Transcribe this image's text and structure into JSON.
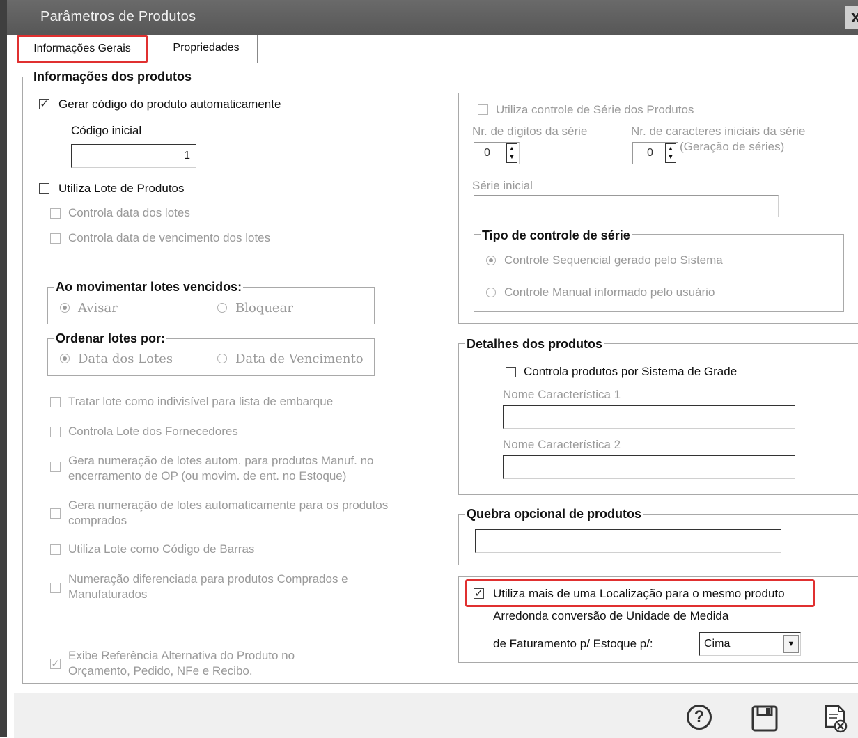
{
  "window": {
    "title": "Parâmetros de Produtos",
    "close_symbol": "x"
  },
  "tabs": [
    {
      "label": "Informações Gerais",
      "active": true
    },
    {
      "label": "Propriedades",
      "active": false
    }
  ],
  "info_produtos": {
    "legend": "Informações dos produtos",
    "gerar_codigo": {
      "label": "Gerar código do produto automaticamente",
      "checked": true
    },
    "codigo_inicial": {
      "label": "Código inicial",
      "value": "1"
    },
    "utiliza_lote": {
      "label": "Utiliza Lote de Produtos",
      "checked": false
    },
    "controla_data_lotes": {
      "label": "Controla data dos lotes",
      "checked": false
    },
    "controla_vencimento": {
      "label": "Controla data de vencimento dos lotes",
      "checked": false
    },
    "lotes_vencidos": {
      "legend": "Ao movimentar lotes vencidos:",
      "options": [
        "Avisar",
        "Bloquear"
      ],
      "selected": "Avisar"
    },
    "ordenar_lotes": {
      "legend": "Ordenar lotes por:",
      "options": [
        "Data dos Lotes",
        "Data de Vencimento"
      ],
      "selected": "Data dos Lotes"
    },
    "tratar_indivisivel": {
      "label": "Tratar lote como indivisível para lista de embarque",
      "checked": false
    },
    "controla_fornecedores": {
      "label": "Controla Lote dos Fornecedores",
      "checked": false
    },
    "gera_numeracao_manuf": {
      "line1": "Gera numeração de lotes autom. para produtos Manuf. no",
      "line2": "encerramento de OP (ou movim. de ent. no Estoque)",
      "checked": false
    },
    "gera_numeracao_comprados": {
      "line1": "Gera numeração de lotes automaticamente para os produtos",
      "line2": "comprados",
      "checked": false
    },
    "lote_codigo_barras": {
      "label": "Utiliza Lote como Código de Barras",
      "checked": false
    },
    "numeracao_diferenciada": {
      "line1": "Numeração diferenciada para produtos Comprados e",
      "line2": "Manufaturados",
      "checked": false
    },
    "exibe_referencia": {
      "line1": "Exibe Referência Alternativa do Produto no",
      "line2": "Orçamento, Pedido, NFe e Recibo.",
      "checked": true
    }
  },
  "serie": {
    "utiliza_controle": {
      "label": "Utiliza controle de Série dos Produtos",
      "checked": false
    },
    "digitos_label": "Nr. de dígitos da série",
    "digitos_value": "0",
    "caracteres_label": "Nr. de caracteres iniciais da série",
    "caracteres_value": "0",
    "caracteres_note": "(Geração de séries)",
    "serie_inicial_label": "Série inicial",
    "serie_inicial_value": "",
    "tipo": {
      "legend": "Tipo de controle de série",
      "options": [
        "Controle Sequencial gerado pelo Sistema",
        "Controle Manual informado pelo usuário"
      ],
      "selected": "Controle Sequencial gerado pelo Sistema"
    }
  },
  "detalhes": {
    "legend": "Detalhes dos produtos",
    "grade": {
      "label": "Controla produtos por Sistema de Grade",
      "checked": false
    },
    "nome_car1_label": "Nome Característica 1",
    "nome_car1_value": "",
    "nome_car2_label": "Nome Característica 2",
    "nome_car2_value": ""
  },
  "quebra": {
    "legend": "Quebra opcional de produtos",
    "value": ""
  },
  "localizacao": {
    "label": "Utiliza mais de uma Localização para o mesmo produto",
    "checked": true,
    "arredonda_line1": "Arredonda conversão de Unidade de Medida",
    "arredonda_line2": "de Faturamento p/ Estoque p/:",
    "arredonda_value": "Cima"
  },
  "footer": {
    "icons": [
      "help-icon",
      "save-icon",
      "cancel-icon"
    ]
  },
  "colors": {
    "highlight": "#e03030",
    "titlebar": "#5f5f5f",
    "disabled_text": "#9a9a9a"
  }
}
